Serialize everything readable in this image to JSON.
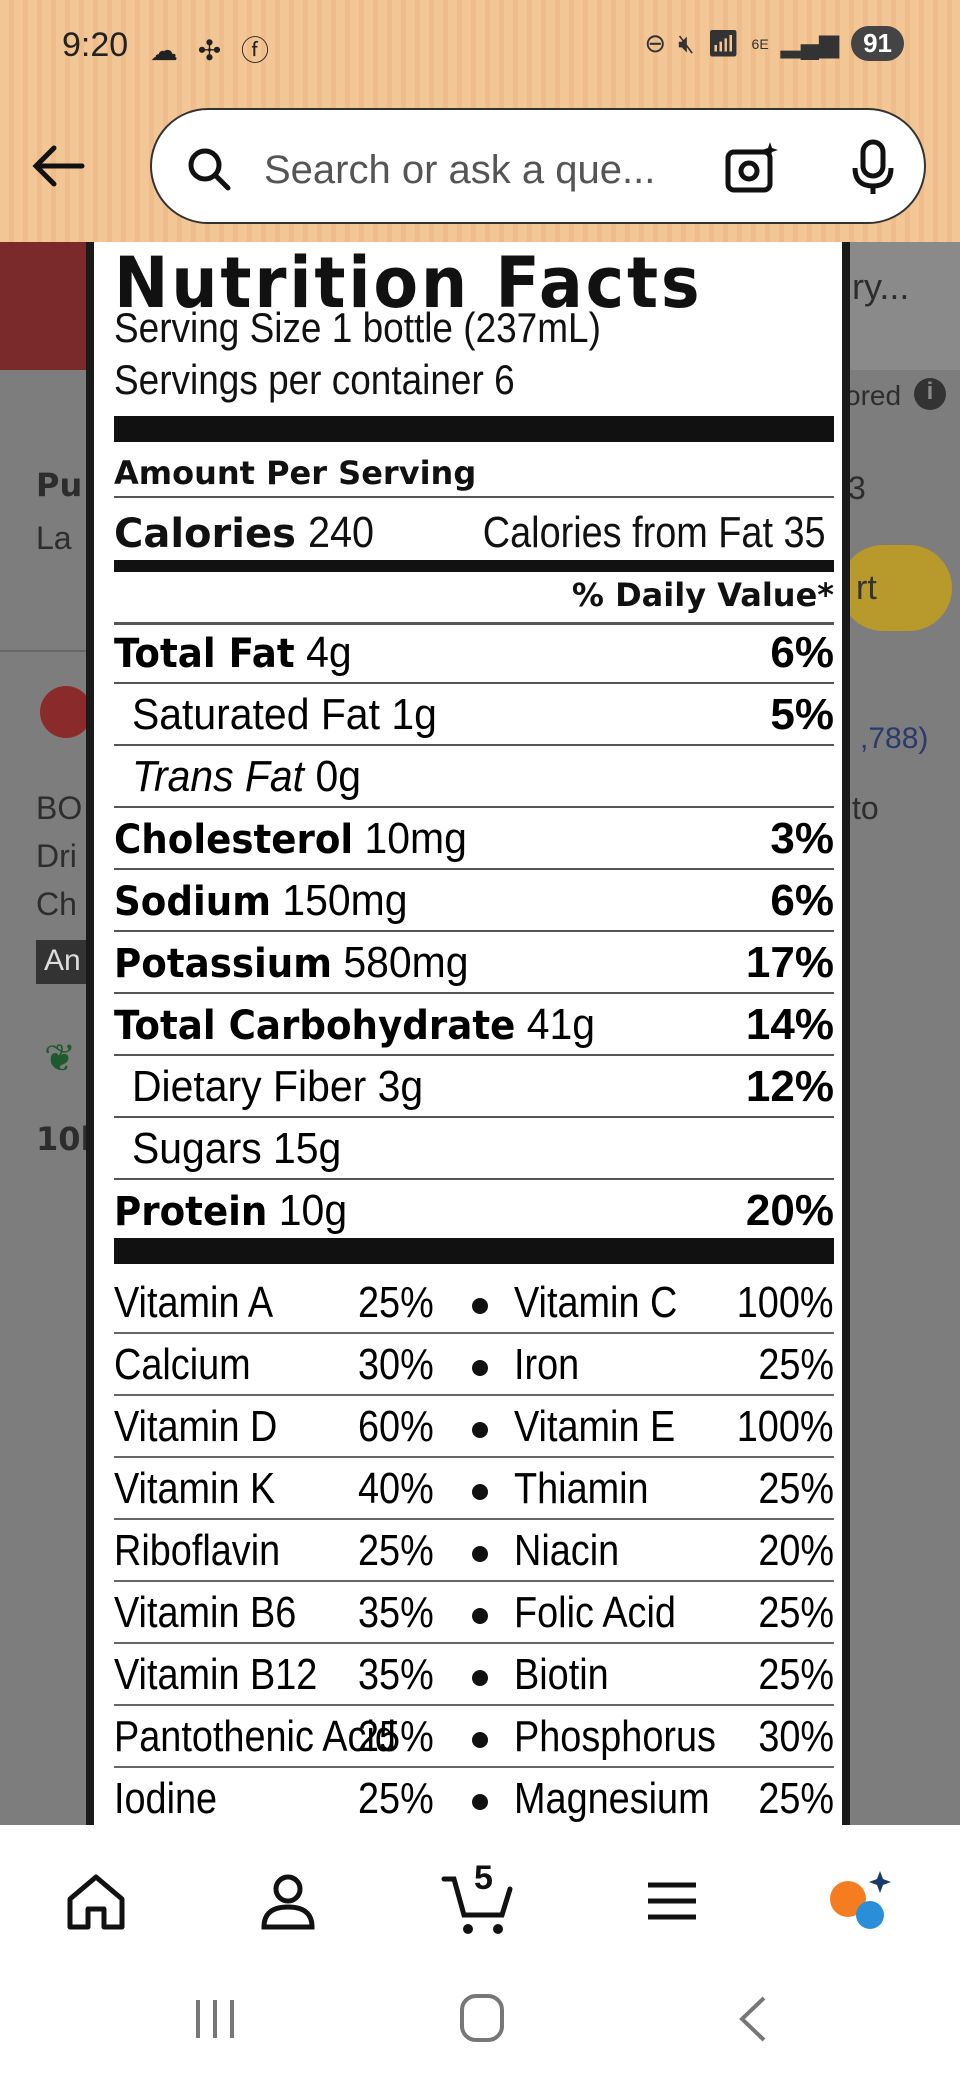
{
  "status_bar": {
    "time": "9:20",
    "left_icons": "☁ ✣ ⓕ",
    "battery": "91",
    "net": "6E"
  },
  "header": {
    "search_placeholder": "Search or ask a que..."
  },
  "background": {
    "item1_title_right": "ry...",
    "sponsored": "ored",
    "item2_left": "Pu",
    "item2_left2": "La",
    "item2_right": "3",
    "add_to_cart": "rt",
    "reviews": ",788)",
    "to": "to",
    "brand_lines": [
      "BO",
      "Dri",
      "Ch"
    ],
    "badge": "An",
    "bought": "10k"
  },
  "nutrition": {
    "title": "Nutrition Facts",
    "serving_size": "Serving Size 1 bottle (237mL)",
    "servings": "Servings per container 6",
    "amount_per_serving": "Amount Per Serving",
    "calories_label": "Calories",
    "calories_value": "240",
    "calories_fat": "Calories from Fat 35",
    "daily_value_header": "% Daily Value*",
    "rows": [
      {
        "name": "Total Fat",
        "amount": "4g",
        "pct": "6%",
        "bold": true
      },
      {
        "name": "Saturated Fat",
        "amount": "1g",
        "pct": "5%",
        "bold": false
      },
      {
        "name": "Trans Fat",
        "amount": "0g",
        "pct": "",
        "bold": false
      },
      {
        "name": "Cholesterol",
        "amount": "10mg",
        "pct": "3%",
        "bold": true
      },
      {
        "name": "Sodium",
        "amount": "150mg",
        "pct": "6%",
        "bold": true
      },
      {
        "name": "Potassium",
        "amount": "580mg",
        "pct": "17%",
        "bold": true
      },
      {
        "name": "Total Carbohydrate",
        "amount": "41g",
        "pct": "14%",
        "bold": true
      },
      {
        "name": "Dietary Fiber",
        "amount": "3g",
        "pct": "12%",
        "bold": false
      },
      {
        "name": "Sugars",
        "amount": "15g",
        "pct": "",
        "bold": false
      },
      {
        "name": "Protein",
        "amount": "10g",
        "pct": "20%",
        "bold": true
      }
    ],
    "vitamins": [
      {
        "a": "Vitamin A",
        "ap": "25%",
        "b": "Vitamin C",
        "bp": "100%"
      },
      {
        "a": "Calcium",
        "ap": "30%",
        "b": "Iron",
        "bp": "25%"
      },
      {
        "a": "Vitamin D",
        "ap": "60%",
        "b": "Vitamin E",
        "bp": "100%"
      },
      {
        "a": "Vitamin K",
        "ap": "40%",
        "b": "Thiamin",
        "bp": "25%"
      },
      {
        "a": "Riboflavin",
        "ap": "25%",
        "b": "Niacin",
        "bp": "20%"
      },
      {
        "a": "Vitamin B6",
        "ap": "35%",
        "b": "Folic Acid",
        "bp": "25%"
      },
      {
        "a": "Vitamin B12",
        "ap": "35%",
        "b": "Biotin",
        "bp": "25%"
      },
      {
        "a": "Pantothenic Acid",
        "ap": "25%",
        "b": "Phosphorus",
        "bp": "30%"
      },
      {
        "a": "Iodine",
        "ap": "25%",
        "b": "Magnesium",
        "bp": "25%"
      }
    ]
  },
  "bottom_nav": {
    "cart_count": "5"
  }
}
